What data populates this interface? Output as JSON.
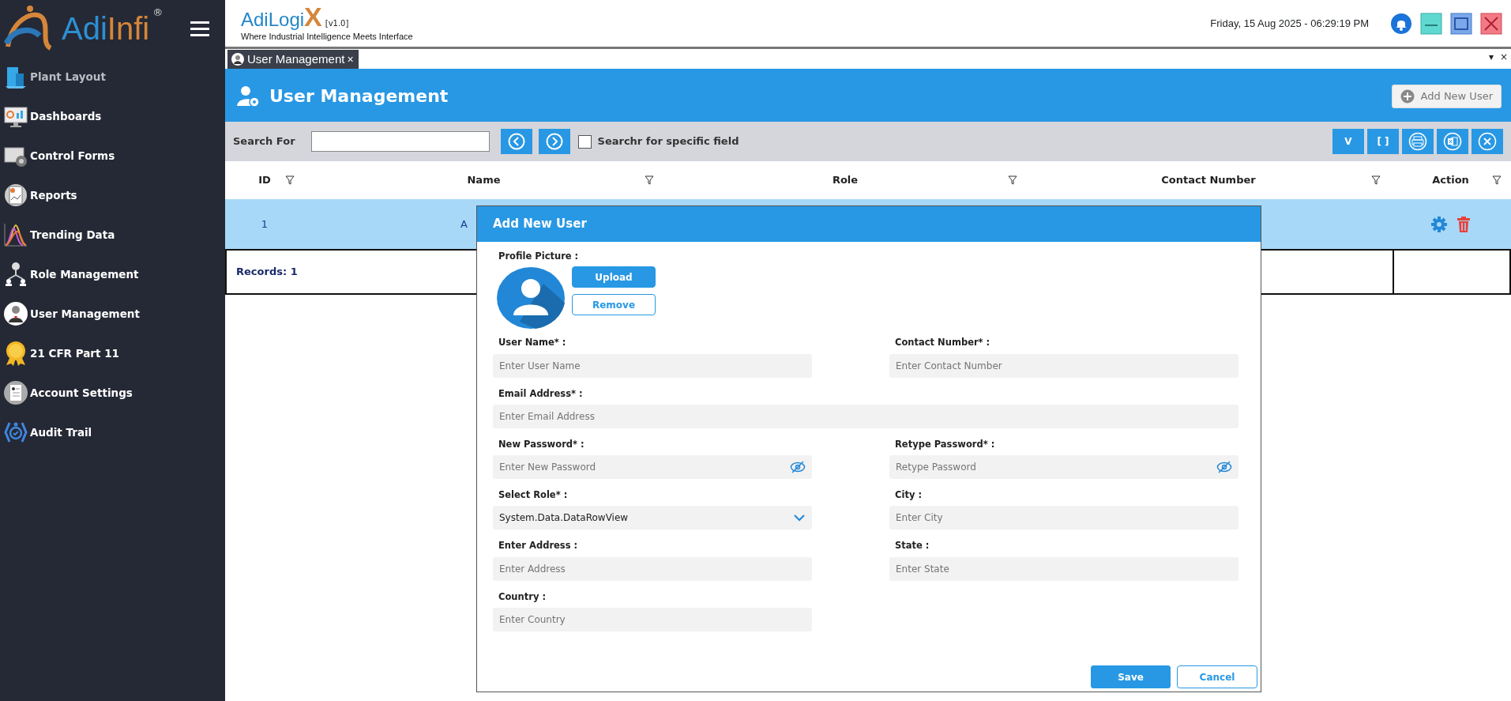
{
  "logo": {
    "part_1": "Adi",
    "part_2": "Infi",
    "mark": "®"
  },
  "sidebar": {
    "items": [
      {
        "label": "Plant Layout",
        "disabled": true
      },
      {
        "label": "Dashboards",
        "disabled": false
      },
      {
        "label": "Control Forms",
        "disabled": false
      },
      {
        "label": "Reports",
        "disabled": false
      },
      {
        "label": "Trending Data",
        "disabled": false
      },
      {
        "label": "Role Management",
        "disabled": false
      },
      {
        "label": "User Management",
        "disabled": false
      },
      {
        "label": "21 CFR Part 11",
        "disabled": false
      },
      {
        "label": "Account Settings",
        "disabled": false
      },
      {
        "label": "Audit Trail",
        "disabled": false
      }
    ]
  },
  "header": {
    "app_name": "AdiLogi",
    "app_name_end": "X",
    "version": "[v1.0]",
    "tagline": "Where Industrial Intelligence Meets Interface",
    "datetime": "Friday, 15 Aug 2025 - 06:29:19 PM"
  },
  "tabs": [
    {
      "label": "User Management",
      "close": "×",
      "selected": true
    }
  ],
  "tab_strip_controls": {
    "dropdown": "▾",
    "close": "×"
  },
  "page": {
    "title": "User Management",
    "add_button": "Add New User"
  },
  "toolbar": {
    "search_label": "Search For",
    "specific_field": {
      "label": "Searchr for specific field",
      "checked": false
    },
    "buttons": [
      "V",
      "[ ]"
    ]
  },
  "table": {
    "columns": [
      "ID",
      "Name",
      "Role",
      "Contact Number",
      "Action"
    ],
    "rows": [
      {
        "id": "1",
        "name": "A",
        "selected": true
      }
    ],
    "footer": "Records: 1"
  },
  "dialog": {
    "title": "Add New User",
    "profile_label": "Profile Picture :",
    "upload": "Upload",
    "remove": "Remove",
    "fields": [
      {
        "label": "User Name* :",
        "placeholder": "Enter User Name",
        "kind": "text"
      },
      {
        "label": "Contact Number* :",
        "placeholder": "Enter Contact Number",
        "kind": "text"
      },
      {
        "label": "Email Address* :",
        "placeholder": "Enter Email Address",
        "kind": "wide"
      },
      {
        "label": "New Password* :",
        "placeholder": "Enter New Password",
        "kind": "password"
      },
      {
        "label": "Retype Password* :",
        "placeholder": "Retype Password",
        "kind": "password"
      },
      {
        "label": "Select Role* :",
        "value": "System.Data.DataRowView",
        "kind": "select"
      },
      {
        "label": "City :",
        "placeholder": "Enter City",
        "kind": "text"
      },
      {
        "label": "Enter Address :",
        "placeholder": "Enter Address",
        "kind": "text"
      },
      {
        "label": "State :",
        "placeholder": "Enter State",
        "kind": "text"
      },
      {
        "label": "Country :",
        "placeholder": "Enter Country",
        "kind": "text"
      }
    ],
    "save": "Save",
    "cancel": "Cancel"
  }
}
